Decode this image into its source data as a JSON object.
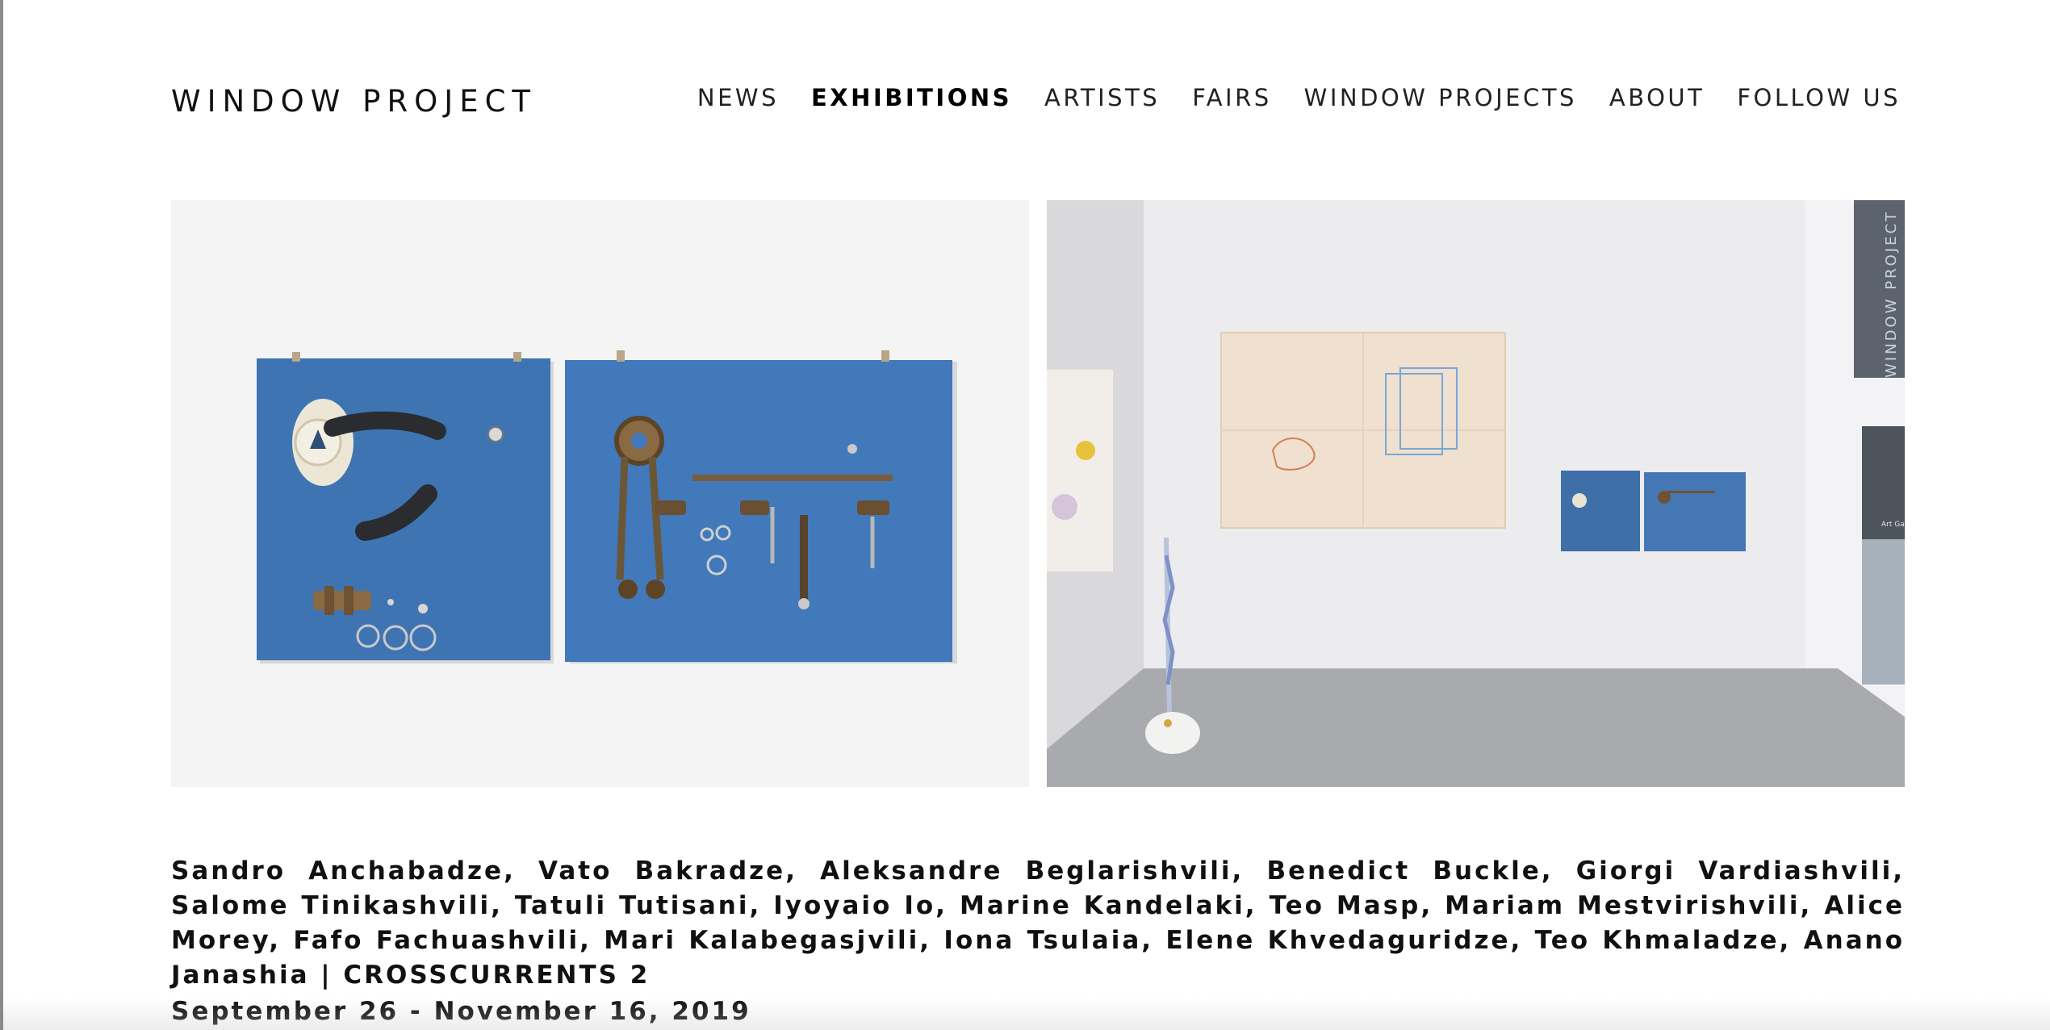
{
  "header": {
    "logo": "WINDOW PROJECT",
    "nav": [
      {
        "label": "NEWS",
        "active": false
      },
      {
        "label": "EXHIBITIONS",
        "active": true
      },
      {
        "label": "ARTISTS",
        "active": false
      },
      {
        "label": "FAIRS",
        "active": false
      },
      {
        "label": "WINDOW PROJECTS",
        "active": false
      },
      {
        "label": "ABOUT",
        "active": false
      },
      {
        "label": "FOLLOW US",
        "active": false
      }
    ]
  },
  "gallery": {
    "left_image_alt": "Two blue panels with mounted car parts",
    "right_image_alt": "Gallery installation view",
    "wall_text": "WINDOW PROJECT",
    "wall_small_text": "Art Gallery"
  },
  "exhibition": {
    "artists": "Sandro Anchabadze, Vato Bakradze, Aleksandre Beglarishvili, Benedict Buckle, Giorgi Vardiashvili, Salome Tinikashvili, Tatuli Tutisani, Iyoyaio Io, Marine Kandelaki, Teo Masp, Mariam Mestvirishvili, Alice Morey, Fafo Fachuashvili, Mari Kalabegasjvili, Iona Tsulaia, Elene Khvedaguridze, Teo Khmaladze, Anano Janashia |",
    "title": "CROSSCURRENTS 2",
    "dates": "September 26 - November 16, 2019"
  },
  "colors": {
    "panel_blue": "#3f74b3",
    "text": "#111111",
    "floor": "#a9aaad"
  }
}
